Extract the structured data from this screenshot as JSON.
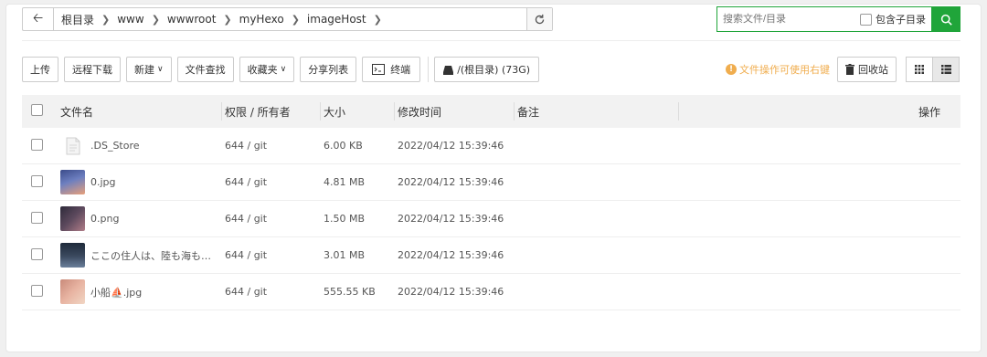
{
  "path": {
    "crumbs": [
      "根目录",
      "www",
      "wwwroot",
      "myHexo",
      "imageHost"
    ]
  },
  "search": {
    "placeholder": "搜索文件/目录",
    "include_sub": "包含子目录"
  },
  "toolbar": {
    "upload": "上传",
    "remote_download": "远程下载",
    "new": "新建",
    "find": "文件查找",
    "favorites": "收藏夹",
    "share_list": "分享列表",
    "terminal": "终端",
    "disk": "/(根目录) (73G)",
    "tip": "文件操作可使用右键",
    "recycle": "回收站"
  },
  "table": {
    "headers": {
      "name": "文件名",
      "perm": "权限 / 所有者",
      "size": "大小",
      "time": "修改时间",
      "note": "备注",
      "op": "操作"
    },
    "rows": [
      {
        "name": ".DS_Store",
        "perm": "644 / git",
        "size": "6.00 KB",
        "time": "2022/04/12 15:39:46",
        "icon": "document-icon"
      },
      {
        "name": "0.jpg",
        "perm": "644 / git",
        "size": "4.81 MB",
        "time": "2022/04/12 15:39:46",
        "icon": "image-thumbnail",
        "colors": [
          "#3b4b8a",
          "#e8a07a"
        ]
      },
      {
        "name": "0.png",
        "perm": "644 / git",
        "size": "1.50 MB",
        "time": "2022/04/12 15:39:46",
        "icon": "image-thumbnail",
        "colors": [
          "#2e2a3a",
          "#b07d88"
        ]
      },
      {
        "name": "ここの住人は、陸も海も…",
        "perm": "644 / git",
        "size": "3.01 MB",
        "time": "2022/04/12 15:39:46",
        "icon": "image-thumbnail",
        "colors": [
          "#1e2a3a",
          "#6a7f9a"
        ]
      },
      {
        "name": "小船⛵.jpg",
        "perm": "644 / git",
        "size": "555.55 KB",
        "time": "2022/04/12 15:39:46",
        "icon": "image-thumbnail",
        "colors": [
          "#c98a7a",
          "#f1d6c4"
        ]
      }
    ]
  },
  "colors": {
    "accent": "#20a53a",
    "tip": "#f0ad4e"
  }
}
